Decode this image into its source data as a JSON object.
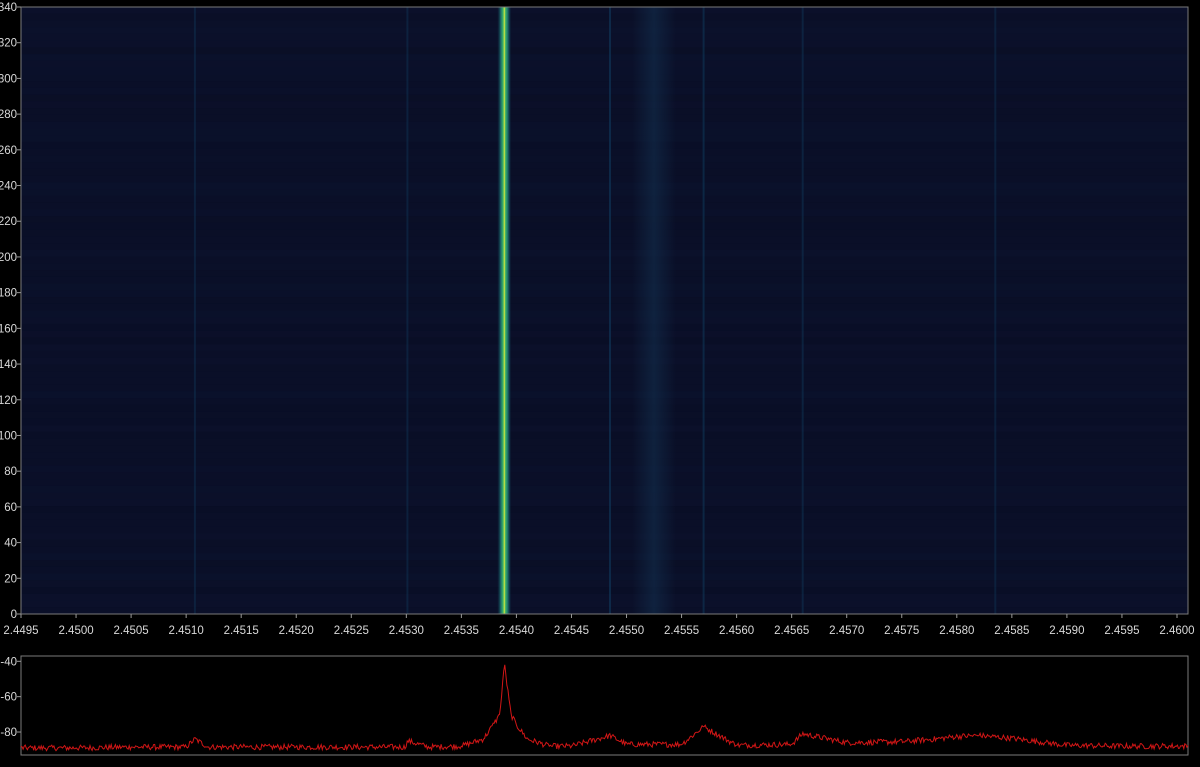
{
  "chart_data": [
    {
      "type": "heatmap",
      "title": "",
      "xlabel": "",
      "ylabel": "",
      "xlim": [
        2.4495,
        2.4601
      ],
      "ylim": [
        0,
        340
      ],
      "x_ticks": [
        "2.4495",
        "2.4500",
        "2.4505",
        "2.4510",
        "2.4515",
        "2.4520",
        "2.4525",
        "2.4530",
        "2.4535",
        "2.4540",
        "2.4545",
        "2.4550",
        "2.4555",
        "2.4560",
        "2.4565",
        "2.4570",
        "2.4575",
        "2.4580",
        "2.4585",
        "2.4590",
        "2.4595",
        "2.4600"
      ],
      "y_ticks": [
        0,
        20,
        40,
        60,
        80,
        100,
        120,
        140,
        160,
        180,
        200,
        220,
        240,
        260,
        280,
        300,
        320,
        340
      ],
      "colormap": [
        "#0a1030",
        "#103a5c",
        "#1d7a72",
        "#3fb768",
        "#c9e23a"
      ],
      "background_color": "#090d24",
      "grid": false,
      "carriers": [
        {
          "freq": 2.45389,
          "intensity": 1.0
        },
        {
          "freq": 2.45485,
          "intensity": 0.18
        },
        {
          "freq": 2.4557,
          "intensity": 0.14
        },
        {
          "freq": 2.45108,
          "intensity": 0.08
        },
        {
          "freq": 2.45301,
          "intensity": 0.08
        },
        {
          "freq": 2.4566,
          "intensity": 0.1
        },
        {
          "freq": 2.45835,
          "intensity": 0.07
        }
      ]
    },
    {
      "type": "line",
      "title": "",
      "xlabel": "",
      "ylabel": "",
      "xlim": [
        2.4495,
        2.4601
      ],
      "ylim": [
        -93,
        -37
      ],
      "y_ticks": [
        -40,
        -60,
        -80
      ],
      "grid": false,
      "series": [
        {
          "color": "#d11616",
          "noise_floor": -89,
          "points": [
            [
              2.4495,
              -89
            ],
            [
              2.45,
              -89
            ],
            [
              2.4505,
              -88.5
            ],
            [
              2.451,
              -88.5
            ],
            [
              2.45108,
              -84
            ],
            [
              2.4512,
              -88.5
            ],
            [
              2.4515,
              -88.5
            ],
            [
              2.452,
              -88.5
            ],
            [
              2.4525,
              -88.5
            ],
            [
              2.453,
              -88.5
            ],
            [
              2.45301,
              -85
            ],
            [
              2.4532,
              -88.5
            ],
            [
              2.4535,
              -88
            ],
            [
              2.4537,
              -84
            ],
            [
              2.4538,
              -75
            ],
            [
              2.45385,
              -70
            ],
            [
              2.45389,
              -42
            ],
            [
              2.45395,
              -70
            ],
            [
              2.454,
              -76
            ],
            [
              2.4541,
              -84
            ],
            [
              2.4543,
              -88
            ],
            [
              2.4545,
              -88
            ],
            [
              2.45485,
              -82
            ],
            [
              2.455,
              -87
            ],
            [
              2.4555,
              -87
            ],
            [
              2.4557,
              -77
            ],
            [
              2.456,
              -87.5
            ],
            [
              2.4565,
              -87
            ],
            [
              2.4566,
              -81
            ],
            [
              2.457,
              -86
            ],
            [
              2.4575,
              -85.5
            ],
            [
              2.4578,
              -84
            ],
            [
              2.458,
              -82.5
            ],
            [
              2.4582,
              -82
            ],
            [
              2.4585,
              -83.5
            ],
            [
              2.4588,
              -86
            ],
            [
              2.459,
              -87.5
            ],
            [
              2.4595,
              -88
            ],
            [
              2.4601,
              -88
            ]
          ]
        }
      ]
    }
  ]
}
